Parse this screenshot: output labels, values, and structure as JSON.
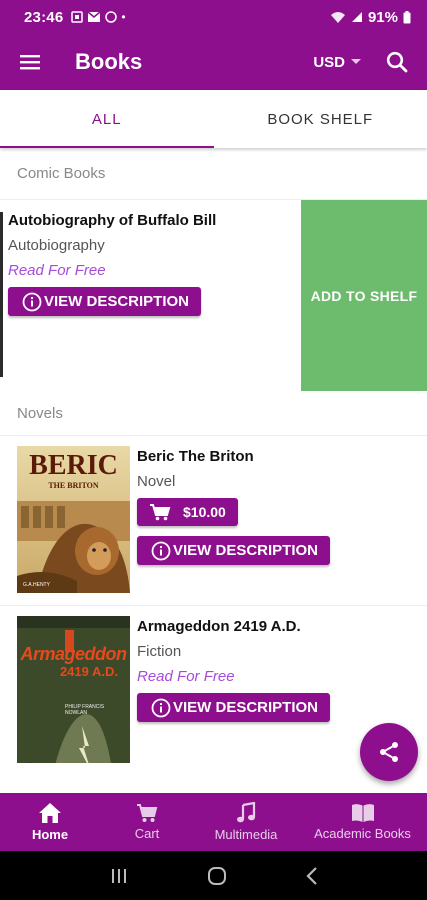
{
  "status_bar": {
    "time": "23:46",
    "battery": "91%"
  },
  "app_bar": {
    "title": "Books",
    "currency": "USD"
  },
  "tabs": [
    {
      "label": "ALL",
      "active": true
    },
    {
      "label": "BOOK SHELF",
      "active": false
    }
  ],
  "sections": [
    {
      "header": "Comic Books",
      "books": [
        {
          "title": "Autobiography of Buffalo Bill",
          "category": "Autobiography",
          "price_label": "Read For Free",
          "description_button": "VIEW DESCRIPTION",
          "swipe_action": "ADD TO SHELF"
        }
      ]
    },
    {
      "header": "Novels",
      "books": [
        {
          "title": "Beric The Briton",
          "category": "Novel",
          "price_button": "$10.00",
          "description_button": "VIEW DESCRIPTION",
          "cover_text": [
            "BERIC",
            "THE BRITON",
            "G.A.HENTY"
          ]
        },
        {
          "title": "Armageddon 2419 A.D.",
          "category": "Fiction",
          "price_label": "Read For Free",
          "description_button": "VIEW DESCRIPTION",
          "cover_text": [
            "Armageddon",
            "2419 A.D.",
            "PHILIP FRANCIS NOWLAN"
          ]
        }
      ]
    }
  ],
  "bottom_nav": [
    {
      "label": "Home",
      "icon": "home-icon",
      "active": true
    },
    {
      "label": "Cart",
      "icon": "cart-icon",
      "active": false
    },
    {
      "label": "Multimedia",
      "icon": "music-note-icon",
      "active": false
    },
    {
      "label": "Academic Books",
      "icon": "book-icon",
      "active": false
    }
  ],
  "colors": {
    "primary": "#8e0f8e",
    "swipe_action": "#6dbb6d",
    "free_label": "#a64bd8"
  }
}
